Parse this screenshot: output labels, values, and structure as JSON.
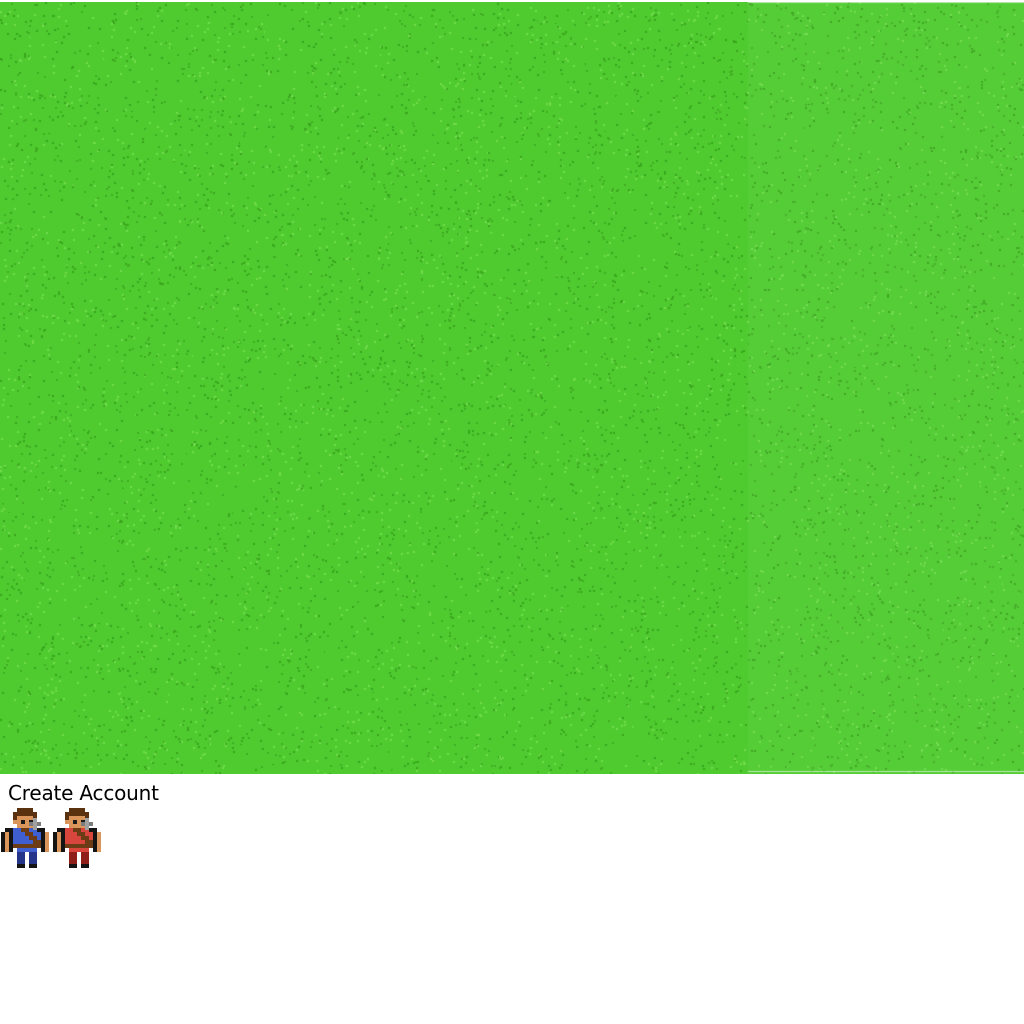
{
  "map": {
    "terrain": "grass",
    "colors": {
      "grass_base": "#4fcb2f",
      "grass_light": "#6fdc4a",
      "grass_dark": "#3fae22",
      "grass_shadow": "#38a51c"
    }
  },
  "account": {
    "create_label": "Create Account"
  },
  "characters": [
    {
      "name": "character-blue",
      "outfit_color": "#3f5fd0",
      "outfit_dark": "#24358a"
    },
    {
      "name": "character-red",
      "outfit_color": "#d8453c",
      "outfit_dark": "#8e1f1a"
    }
  ]
}
